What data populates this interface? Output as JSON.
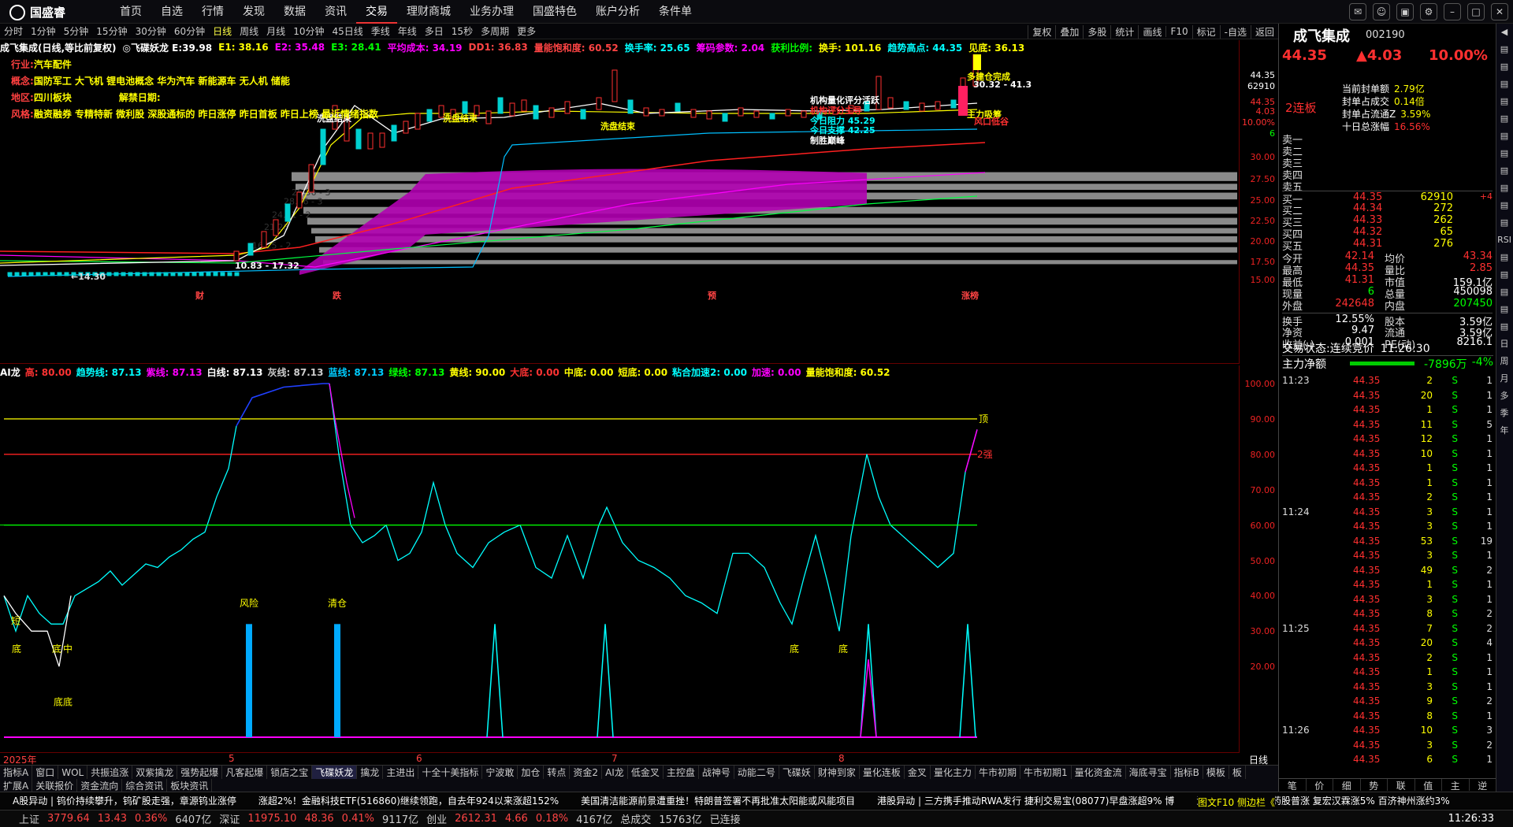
{
  "app": {
    "brand": "国盛睿"
  },
  "topnav": [
    "首页",
    "自选",
    "行情",
    "发现",
    "数据",
    "资讯",
    "交易",
    "理财商城",
    "业务办理",
    "国盛特色",
    "账户分析",
    "条件单"
  ],
  "topnav_active": 6,
  "periods": [
    "分时",
    "1分钟",
    "5分钟",
    "15分钟",
    "30分钟",
    "60分钟",
    "日线",
    "周线",
    "月线",
    "10分钟",
    "45日线",
    "季线",
    "年线",
    "多日",
    "15秒",
    "多周期",
    "更多"
  ],
  "period_active": 6,
  "chart_tools": [
    "复权",
    "叠加",
    "多股",
    "统计",
    "画线",
    "F10",
    "标记",
    "-自选",
    "返回"
  ],
  "row1": [
    {
      "t": "成飞集成(日线,等比前复权)",
      "c": "#ffffff"
    },
    {
      "t": "◎飞碟妖龙 E:39.98",
      "c": "#ffffff"
    },
    {
      "t": "E1: 38.16",
      "c": "#ffff00"
    },
    {
      "t": "E2: 35.48",
      "c": "#ff00ff"
    },
    {
      "t": "E3: 28.41",
      "c": "#00ff00"
    },
    {
      "t": "平均成本: 34.19",
      "c": "#ff00ff"
    },
    {
      "t": "DD1: 36.83",
      "c": "#ff4444"
    },
    {
      "t": "量能饱和度: 60.52",
      "c": "#ff4444"
    },
    {
      "t": "换手率: 25.65",
      "c": "#00ffff"
    },
    {
      "t": "筹码参数: 2.04",
      "c": "#ff00ff"
    },
    {
      "t": "获利比例:",
      "c": "#00ff00"
    },
    {
      "t": "换手: 101.16",
      "c": "#ffff00"
    },
    {
      "t": "趋势高点: 44.35",
      "c": "#00ffff"
    },
    {
      "t": "见底: 36.13",
      "c": "#ffff00"
    }
  ],
  "info_lines": [
    {
      "label": "行业:",
      "text": "汽车配件"
    },
    {
      "label": "概念:",
      "text": "国防军工 大飞机 锂电池概念 华为汽车 新能源车 无人机 储能"
    },
    {
      "label": "地区:",
      "text": "四川板块",
      "extra": "解禁日期:"
    },
    {
      "label": "风格:",
      "text": "融资融券 专精特新 微利股 深股通标的 昨日涨停 昨日首板 昨日上榜 最近情绪指数"
    }
  ],
  "main_chart": {
    "annotations": [
      "洗盘结束",
      "洗盘结束",
      "洗盘结束",
      "机构量化评分活跃",
      "机构评分主导",
      "今日阻力 45.29",
      "今日支撑 42.25",
      "制胜巅峰",
      "多建仓完成",
      "主力吸筹",
      "风口低谷",
      "←14.30",
      "10.83 - 17.32",
      "30.32 - 41.3"
    ],
    "price_high_label": "44.35",
    "ylabels": [
      "44.35",
      "62910",
      "44.35",
      "4.03",
      "10.00%",
      "6",
      "30.00",
      "27.50",
      "25.00",
      "22.50",
      "20.00",
      "17.50",
      "15.00"
    ],
    "xmarks": [
      "财",
      "跌",
      "预",
      "涨榜"
    ],
    "boxes_text": [
      "26.56 - 3",
      "28.96 - 3",
      "24.51 - 2",
      "21.28",
      "16.25 - 2"
    ]
  },
  "ind_header": [
    {
      "t": "AI龙",
      "c": "#ffffff"
    },
    {
      "t": "高: 80.00",
      "c": "#ff3333"
    },
    {
      "t": "趋势线: 87.13",
      "c": "#00ffff"
    },
    {
      "t": "紫线: 87.13",
      "c": "#ff00ff"
    },
    {
      "t": "白线: 87.13",
      "c": "#ffffff"
    },
    {
      "t": "灰线: 87.13",
      "c": "#cccccc"
    },
    {
      "t": "蓝线: 87.13",
      "c": "#00ccff"
    },
    {
      "t": "绿线: 87.13",
      "c": "#00ff00"
    },
    {
      "t": "黄线: 90.00",
      "c": "#ffff00"
    },
    {
      "t": "大底: 0.00",
      "c": "#ff3333"
    },
    {
      "t": "中底: 0.00",
      "c": "#ffff00"
    },
    {
      "t": "短底: 0.00",
      "c": "#ffff00"
    },
    {
      "t": "粘合加速2: 0.00",
      "c": "#00ffff"
    },
    {
      "t": "加速: 0.00",
      "c": "#ff00ff"
    },
    {
      "t": "量能饱和度: 60.52",
      "c": "#ffff00"
    }
  ],
  "ind_ylabels": [
    "100.00",
    "90.00",
    "80.00",
    "70.00",
    "60.00",
    "50.00",
    "40.00",
    "30.00",
    "20.00"
  ],
  "ind_marks": {
    "top": "顶",
    "strong": "2强",
    "risk": "风险",
    "clear": "清仓",
    "bottoms": [
      "底",
      "底",
      "底",
      "底",
      "底底"
    ],
    "short_b": "短",
    "mid": "中"
  },
  "date_axis": [
    "2025年",
    "5",
    "6",
    "7",
    "8"
  ],
  "date_axis_right": "日线",
  "bottom_tabs": [
    "指标A",
    "窗口",
    "WOL",
    "共振追涨",
    "双紫擒龙",
    "强势起爆",
    "凡客起爆",
    "锁店之宝",
    "飞碟妖龙",
    "擒龙",
    "主进出",
    "十全十美指标",
    "宁波敢",
    "加仓",
    "转点",
    "资金2",
    "AI龙",
    "低金叉",
    "主控盘",
    "战神号",
    "动能二号",
    "飞碟妖",
    "财神到家",
    "量化连板",
    "金叉",
    "量化主力",
    "牛市初期",
    "牛市初期1",
    "量化资金流",
    "海底寻宝",
    "指标B",
    "模板",
    "板"
  ],
  "bottom_tabs_active": 8,
  "bottom_tabs2": [
    "扩展A",
    "关联报价",
    "资金流向",
    "综合资讯",
    "板块资讯"
  ],
  "stock": {
    "name": "成飞集成",
    "code": "002190",
    "price": "44.35",
    "change": "▲4.03",
    "pct": "10.00%",
    "limit_label": "2连板"
  },
  "seal": [
    {
      "k": "当前封单额",
      "v": "2.79亿"
    },
    {
      "k": "封单占成交",
      "v": "0.14倍"
    },
    {
      "k": "封单占流通Z",
      "v": "3.59%"
    },
    {
      "k": "十日总涨幅",
      "v": "16.56%"
    }
  ],
  "orderbook": [
    {
      "k": "卖一",
      "p": "",
      "v": "",
      "c": ""
    },
    {
      "k": "卖二",
      "p": "",
      "v": "",
      "c": ""
    },
    {
      "k": "卖三",
      "p": "",
      "v": "",
      "c": ""
    },
    {
      "k": "卖四",
      "p": "",
      "v": "",
      "c": ""
    },
    {
      "k": "卖五",
      "p": "",
      "v": "",
      "c": ""
    },
    {
      "k": "买一",
      "p": "44.35",
      "v": "62910",
      "c": "+4"
    },
    {
      "k": "买二",
      "p": "44.34",
      "v": "272",
      "c": ""
    },
    {
      "k": "买三",
      "p": "44.33",
      "v": "262",
      "c": ""
    },
    {
      "k": "买四",
      "p": "44.32",
      "v": "65",
      "c": ""
    },
    {
      "k": "买五",
      "p": "44.31",
      "v": "276",
      "c": ""
    }
  ],
  "quote": [
    {
      "k1": "今开",
      "v1": "42.14",
      "k2": "均价",
      "v2": "43.34"
    },
    {
      "k1": "最高",
      "v1": "44.35",
      "k2": "量比",
      "v2": "2.85"
    },
    {
      "k1": "最低",
      "v1": "41.31",
      "k2": "市值",
      "v2": "159.1亿"
    },
    {
      "k1": "现量",
      "v1": "6",
      "k2": "总量",
      "v2": "450098"
    },
    {
      "k1": "外盘",
      "v1": "242648",
      "k2": "内盘",
      "v2": "207450"
    },
    {
      "k1": "换手",
      "v1": "12.55%",
      "k2": "股本",
      "v2": "3.59亿"
    },
    {
      "k1": "净资",
      "v1": "9.47",
      "k2": "流通",
      "v2": "3.59亿"
    },
    {
      "k1": "收益(-)",
      "v1": "0.001",
      "k2": "PE(动)",
      "v2": "8216.1"
    }
  ],
  "trade_state": {
    "label": "交易状态:",
    "text": "连续竞价",
    "time": "11:26:30"
  },
  "mainflow": {
    "label": "主力净额",
    "value": "-7896万",
    "pct": "-4%"
  },
  "ticks": [
    {
      "t": "11:23",
      "p": "44.35",
      "v": "2",
      "d": "S",
      "n": "1"
    },
    {
      "t": "",
      "p": "44.35",
      "v": "20",
      "d": "S",
      "n": "1"
    },
    {
      "t": "",
      "p": "44.35",
      "v": "1",
      "d": "S",
      "n": "1"
    },
    {
      "t": "",
      "p": "44.35",
      "v": "11",
      "d": "S",
      "n": "5"
    },
    {
      "t": "",
      "p": "44.35",
      "v": "12",
      "d": "S",
      "n": "1"
    },
    {
      "t": "",
      "p": "44.35",
      "v": "10",
      "d": "S",
      "n": "1"
    },
    {
      "t": "",
      "p": "44.35",
      "v": "1",
      "d": "S",
      "n": "1"
    },
    {
      "t": "",
      "p": "44.35",
      "v": "1",
      "d": "S",
      "n": "1"
    },
    {
      "t": "",
      "p": "44.35",
      "v": "2",
      "d": "S",
      "n": "1"
    },
    {
      "t": "11:24",
      "p": "44.35",
      "v": "3",
      "d": "S",
      "n": "1"
    },
    {
      "t": "",
      "p": "44.35",
      "v": "3",
      "d": "S",
      "n": "1"
    },
    {
      "t": "",
      "p": "44.35",
      "v": "53",
      "d": "S",
      "n": "19"
    },
    {
      "t": "",
      "p": "44.35",
      "v": "3",
      "d": "S",
      "n": "1"
    },
    {
      "t": "",
      "p": "44.35",
      "v": "49",
      "d": "S",
      "n": "2"
    },
    {
      "t": "",
      "p": "44.35",
      "v": "1",
      "d": "S",
      "n": "1"
    },
    {
      "t": "",
      "p": "44.35",
      "v": "3",
      "d": "S",
      "n": "1"
    },
    {
      "t": "",
      "p": "44.35",
      "v": "8",
      "d": "S",
      "n": "2"
    },
    {
      "t": "11:25",
      "p": "44.35",
      "v": "7",
      "d": "S",
      "n": "2"
    },
    {
      "t": "",
      "p": "44.35",
      "v": "20",
      "d": "S",
      "n": "4"
    },
    {
      "t": "",
      "p": "44.35",
      "v": "2",
      "d": "S",
      "n": "1"
    },
    {
      "t": "",
      "p": "44.35",
      "v": "1",
      "d": "S",
      "n": "1"
    },
    {
      "t": "",
      "p": "44.35",
      "v": "3",
      "d": "S",
      "n": "1"
    },
    {
      "t": "",
      "p": "44.35",
      "v": "9",
      "d": "S",
      "n": "2"
    },
    {
      "t": "",
      "p": "44.35",
      "v": "8",
      "d": "S",
      "n": "1"
    },
    {
      "t": "11:26",
      "p": "44.35",
      "v": "10",
      "d": "S",
      "n": "3"
    },
    {
      "t": "",
      "p": "44.35",
      "v": "3",
      "d": "S",
      "n": "2"
    },
    {
      "t": "",
      "p": "44.35",
      "v": "6",
      "d": "S",
      "n": "1"
    }
  ],
  "side_strip": [
    "◀",
    "▤",
    "▤",
    "▤",
    "▤",
    "▤",
    "▤",
    "▤",
    "▤",
    "▤",
    "▤",
    "▤",
    "RSI",
    "▤",
    "▤",
    "▤",
    "▤",
    "▤",
    "日",
    "周",
    "月",
    "多",
    "季",
    "年"
  ],
  "right_tabs": [
    "笔",
    "价",
    "细",
    "势",
    "联",
    "值",
    "主",
    "逆"
  ],
  "ticker_items": [
    "A股异动 | 钨价持续攀升，钨矿股走强，章源钨业涨停",
    "涨超2%！金融科技ETF(516860)继续领跑，自去年924以来涨超152%",
    "美国清洁能源前景遭重挫！特朗普签署不再批准太阳能或风能项目",
    "港股异动 | 三方携手推动RWA发行 捷利交易宝(08077)早盘涨超9% 博",
    "港股异动 | 生物医药股普涨 复宏汉霖涨5% 百济神州涨约3%"
  ],
  "ticker_right": "图文F10 侧边栏《",
  "status": [
    {
      "t": "上证",
      "c": "#ccc"
    },
    {
      "t": "3779.64",
      "c": "#ff4444"
    },
    {
      "t": "13.43",
      "c": "#ff4444"
    },
    {
      "t": "0.36%",
      "c": "#ff4444"
    },
    {
      "t": "6407亿",
      "c": "#ccc"
    },
    {
      "t": "深证",
      "c": "#ccc"
    },
    {
      "t": "11975.10",
      "c": "#ff4444"
    },
    {
      "t": "48.36",
      "c": "#ff4444"
    },
    {
      "t": "0.41%",
      "c": "#ff4444"
    },
    {
      "t": "9117亿",
      "c": "#ccc"
    },
    {
      "t": "创业",
      "c": "#ccc"
    },
    {
      "t": "2612.31",
      "c": "#ff4444"
    },
    {
      "t": "4.66",
      "c": "#ff4444"
    },
    {
      "t": "0.18%",
      "c": "#ff4444"
    },
    {
      "t": "4167亿",
      "c": "#ccc"
    },
    {
      "t": "总成交",
      "c": "#ccc"
    },
    {
      "t": "15763亿",
      "c": "#ccc"
    },
    {
      "t": "已连接",
      "c": "#ccc"
    }
  ],
  "clock": "11:26:33"
}
